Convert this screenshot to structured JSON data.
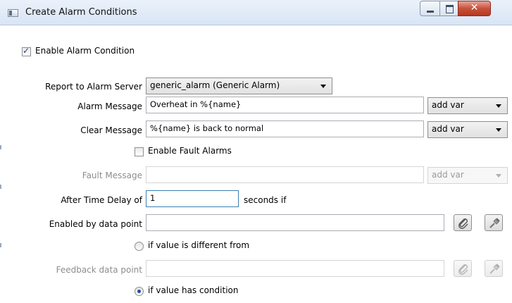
{
  "window": {
    "title": "Create Alarm Conditions"
  },
  "enable_alarm": {
    "label": "Enable Alarm Condition",
    "checked": true
  },
  "report_server": {
    "label": "Report to Alarm Server",
    "value": "generic_alarm (Generic Alarm)"
  },
  "alarm_message": {
    "label": "Alarm Message",
    "value": "Overheat in %{name}",
    "var_select": "add var"
  },
  "clear_message": {
    "label": "Clear Message",
    "value": "%{name} is back to normal",
    "var_select": "add var"
  },
  "enable_fault": {
    "label": "Enable Fault Alarms",
    "checked": false
  },
  "fault_message": {
    "label": "Fault Message",
    "value": "",
    "var_select": "add var"
  },
  "time_delay": {
    "label": "After Time Delay of",
    "value": "1",
    "unit": "seconds if"
  },
  "enabled_by": {
    "label": "Enabled by data point",
    "value": ""
  },
  "radio_different": {
    "label": "if value is different from",
    "checked": false
  },
  "feedback": {
    "label": "Feedback data point",
    "value": ""
  },
  "radio_condition": {
    "label": "if value has condition",
    "checked": true
  },
  "icons": {
    "attach": "paperclip-icon",
    "picker": "eyedropper-icon"
  }
}
